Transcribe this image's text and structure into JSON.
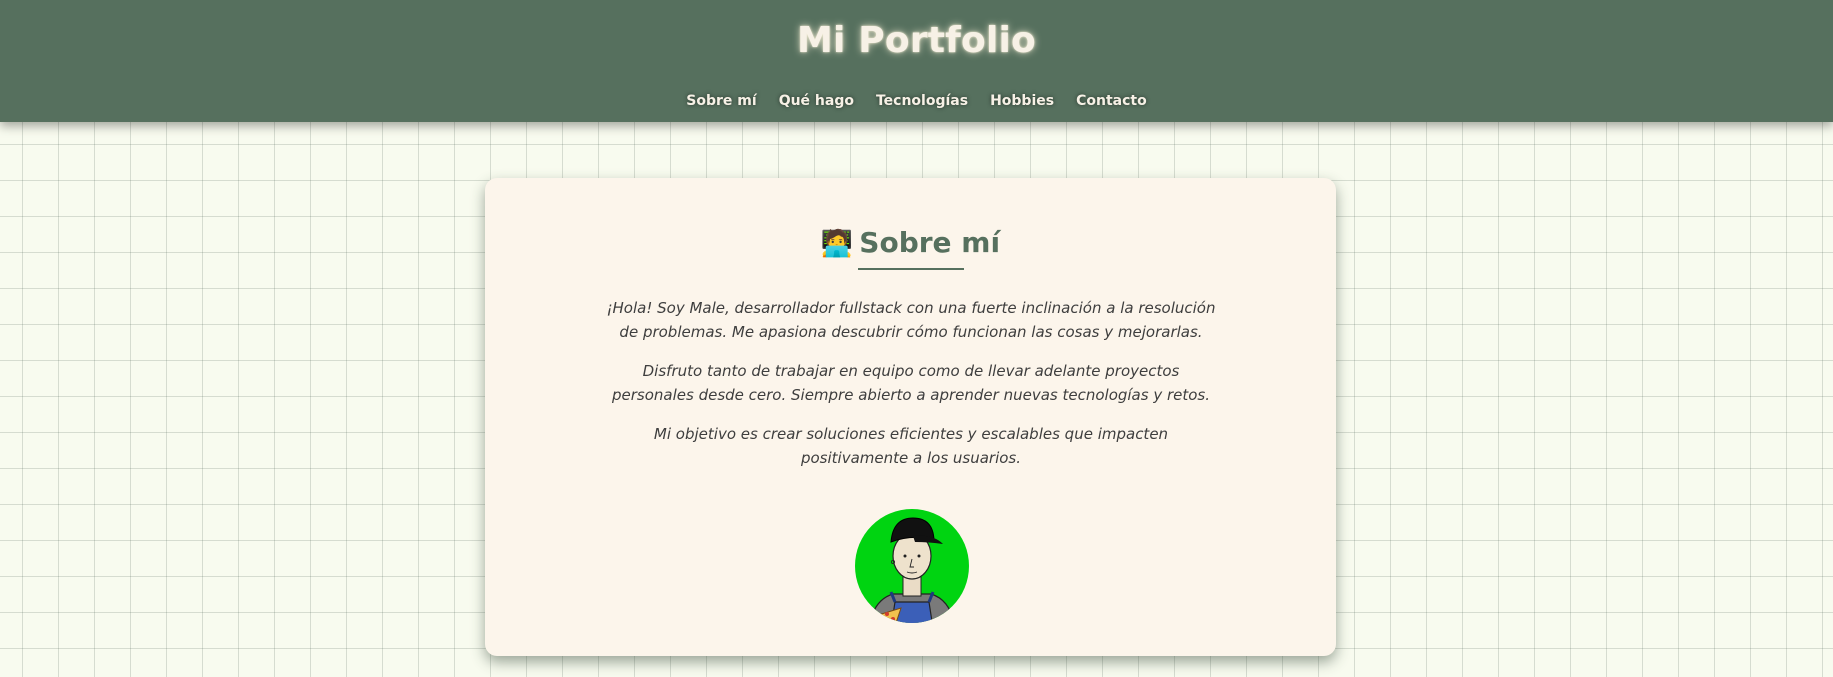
{
  "header": {
    "title": "Mi Portfolio",
    "nav": [
      "Sobre mí",
      "Qué hago",
      "Tecnologías",
      "Hobbies",
      "Contacto"
    ]
  },
  "about": {
    "emoji": "🧑‍💻",
    "title": "Sobre mí",
    "paragraphs": [
      "¡Hola! Soy Male, desarrollador fullstack con una fuerte inclinación a la resolución de problemas. Me apasiona descubrir cómo funcionan las cosas y mejorarlas.",
      "Disfruto tanto de trabajar en equipo como de llevar adelante proyectos personales desde cero. Siempre abierto a aprender nuevas tecnologías y retos.",
      "Mi objetivo es crear soluciones eficientes y escalables que impacten positivamente a los usuarios."
    ]
  },
  "colors": {
    "header_bg": "#56705e",
    "page_bg": "#f8fbef",
    "card_bg": "#fcf5eb",
    "accent": "#56705e",
    "avatar_bg": "#00d411"
  }
}
